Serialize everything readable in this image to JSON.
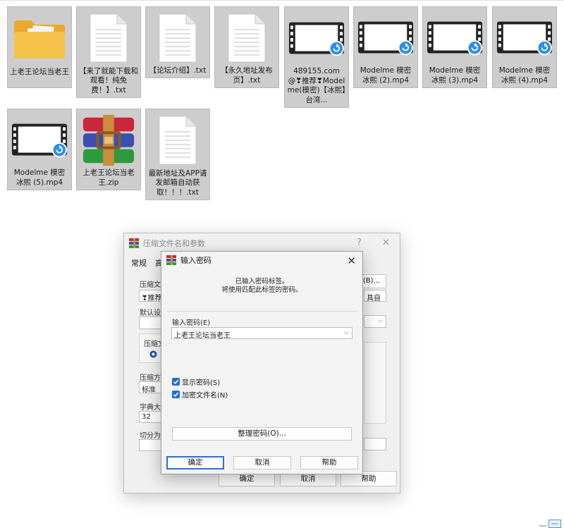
{
  "files": [
    {
      "name": "上老王论坛当老王",
      "type": "folder"
    },
    {
      "name": "【来了就能下载和观看！纯免费！】.txt",
      "type": "txt"
    },
    {
      "name": "【论坛介绍】.txt",
      "type": "txt"
    },
    {
      "name": "【永久地址发布页】.txt",
      "type": "txt"
    },
    {
      "name": "489155.com@❣推荐❣Modelme(模密)【冰熙】台湾...",
      "type": "video"
    },
    {
      "name": "Modelme 模密 冰熙 (2).mp4",
      "type": "video"
    },
    {
      "name": "Modelme 模密 冰熙 (3).mp4",
      "type": "video"
    },
    {
      "name": "Modelme 模密 冰熙 (4).mp4",
      "type": "video"
    },
    {
      "name": "Modelme 模密 冰熙 (5).mp4",
      "type": "video"
    },
    {
      "name": "上老王论坛当老王.zip",
      "type": "zip"
    },
    {
      "name": "最新地址及APP请发邮箱自动获取！！！.txt",
      "type": "txt"
    }
  ],
  "back_dialog": {
    "title": "压缩文件名和参数",
    "help_glyph": "?",
    "close_glyph": "✕",
    "tab_general": "常规",
    "tab_second": "高",
    "label_archive": "压缩文件",
    "archive_value": "❣推荐",
    "browse_button": "(B)...",
    "profile_value": "具自",
    "label_default": "默认设置",
    "label_format": "压缩文",
    "label_method": "压缩方式",
    "method_value": "标准",
    "label_dict": "字典大小",
    "dict_value": "32",
    "label_split": "切分为分",
    "ok_button": "确定",
    "cancel_button": "取消",
    "help_button": "帮助"
  },
  "password_dialog": {
    "title": "输入密码",
    "close_glyph": "✕",
    "info_line1": "已输入密码标签。",
    "info_line2": "将使用匹配此标签的密码。",
    "label_password": "输入密码(E)",
    "password_value": "上老王论坛当老王",
    "show_password": "显示密码(S)",
    "encrypt_names": "加密文件名(N)",
    "organize_button": "整理密码(O)...",
    "ok_button": "确定",
    "cancel_button": "取消",
    "help_button": "帮助"
  },
  "colors": {
    "tile_bg": "#cdcdcd",
    "accent": "#1f6fd1",
    "folder": "#f2c24d"
  }
}
